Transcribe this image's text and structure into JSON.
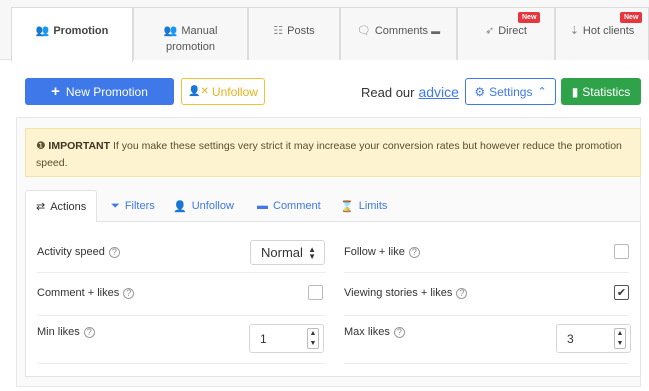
{
  "top_tabs": [
    {
      "label": "Promotion",
      "icon": "users-icon",
      "active": true
    },
    {
      "label": "Manual promotion",
      "icon": "users-icon",
      "active": false
    },
    {
      "label": "Posts",
      "icon": "grid-icon",
      "active": false
    },
    {
      "label": "Comments",
      "icon": "comment-icon",
      "active": false
    },
    {
      "label": "Direct",
      "icon": "paper-plane-icon",
      "badge": "New",
      "active": false
    },
    {
      "label": "Hot clients",
      "icon": "hot-icon",
      "badge": "New",
      "active": false
    }
  ],
  "toolbar": {
    "new_promotion": "New Promotion",
    "unfollow": "Unfollow",
    "read_prefix": "Read our",
    "advice_link": "advice",
    "settings": "Settings",
    "statistics": "Statistics"
  },
  "notice": {
    "strong": "IMPORTANT",
    "text": "If you make these settings very strict it may increase your conversion rates but however reduce the promotion speed."
  },
  "sub_tabs": [
    {
      "label": "Actions",
      "icon": "exchange-icon",
      "active": true
    },
    {
      "label": "Filters",
      "icon": "filter-icon",
      "active": false
    },
    {
      "label": "Unfollow",
      "icon": "user-x-icon",
      "active": false
    },
    {
      "label": "Comment",
      "icon": "comment-icon",
      "active": false
    },
    {
      "label": "Limits",
      "icon": "hourglass-icon",
      "active": false
    }
  ],
  "settings": {
    "activity_speed": {
      "label": "Activity speed",
      "value": "Normal"
    },
    "follow_like": {
      "label": "Follow + like",
      "checked": false
    },
    "comment_likes": {
      "label": "Comment + likes",
      "checked": false
    },
    "viewing_stories": {
      "label": "Viewing stories + likes",
      "checked": true
    },
    "min_likes": {
      "label": "Min likes",
      "value": "1"
    },
    "max_likes": {
      "label": "Max likes",
      "value": "3"
    }
  },
  "colors": {
    "primary": "#3e78e9",
    "warning": "#f2c233",
    "success": "#2fa34a",
    "danger_badge": "#e6373f",
    "notice_bg": "#fdf3d0"
  }
}
